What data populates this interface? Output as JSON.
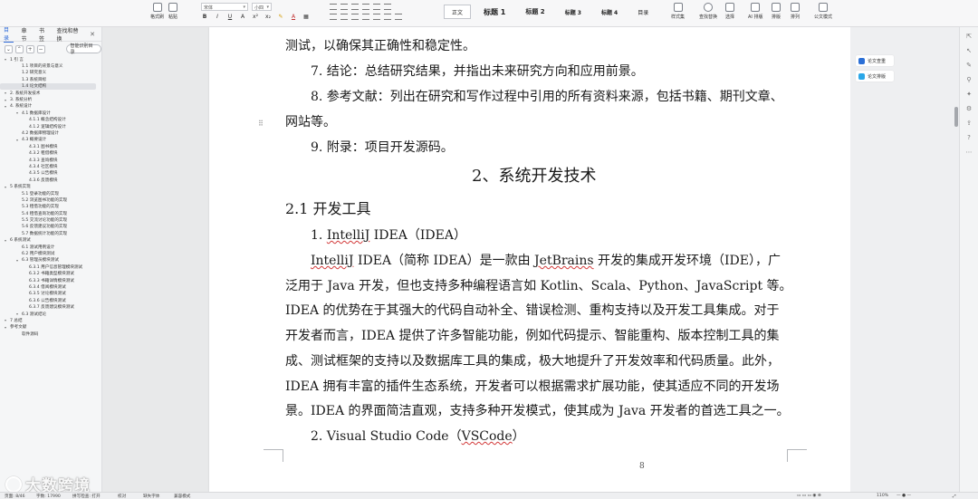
{
  "ribbon": {
    "clipboard": [
      {
        "label": "格式刷"
      },
      {
        "label": "粘贴"
      }
    ],
    "font_name": "宋体",
    "font_size": "小四",
    "styles": [
      {
        "label": "正文"
      },
      {
        "label": "标题 1"
      },
      {
        "label": "标题 2"
      },
      {
        "label": "标题 3"
      },
      {
        "label": "标题 4"
      },
      {
        "label": "目录"
      }
    ],
    "tools": [
      {
        "label": "样式集"
      },
      {
        "label": "查找替换"
      },
      {
        "label": "选择"
      },
      {
        "label": "AI 排版"
      },
      {
        "label": "排版"
      },
      {
        "label": "排列"
      },
      {
        "label": "公文模式"
      }
    ]
  },
  "nav": {
    "tabs": [
      {
        "label": "目录"
      },
      {
        "label": "章节"
      },
      {
        "label": "书签"
      },
      {
        "label": "查找和替换"
      }
    ],
    "smart_label": "智能识别目录",
    "toc": [
      {
        "label": "1  引 言",
        "level": 0
      },
      {
        "label": "1.1  项目的背景与意义",
        "level": 1
      },
      {
        "label": "1.2  研究意义",
        "level": 1
      },
      {
        "label": "1.3  系统目标",
        "level": 1
      },
      {
        "label": "1.4  论文结构",
        "level": 1,
        "selected": true
      },
      {
        "label": "2.  系统开发技术",
        "level": 0
      },
      {
        "label": "3.  系统分析",
        "level": 0
      },
      {
        "label": "4.  系统设计",
        "level": 0
      },
      {
        "label": "4.1  数据库设计",
        "level": 1
      },
      {
        "label": "4.1.1  概念结构设计",
        "level": 2
      },
      {
        "label": "4.1.2  逻辑结构设计",
        "level": 2
      },
      {
        "label": "4.2  数据库物理设计",
        "level": 1
      },
      {
        "label": "4.3  概要设计",
        "level": 1
      },
      {
        "label": "4.3.1  图书模块",
        "level": 2
      },
      {
        "label": "4.3.2  租借模块",
        "level": 2
      },
      {
        "label": "4.3.3  查询模块",
        "level": 2
      },
      {
        "label": "4.3.4  社区模块",
        "level": 2
      },
      {
        "label": "4.3.5  公告模块",
        "level": 2
      },
      {
        "label": "4.3.6  反馈模块",
        "level": 2
      },
      {
        "label": "5  系统实现",
        "level": 0
      },
      {
        "label": "5.1  登录功能的实现",
        "level": 1
      },
      {
        "label": "5.2  浏览图书功能的实现",
        "level": 1
      },
      {
        "label": "5.3  租借功能的实现",
        "level": 1
      },
      {
        "label": "5.4  租借查询功能的实现",
        "level": 1
      },
      {
        "label": "5.5  交流讨论功能的实现",
        "level": 1
      },
      {
        "label": "5.6  反馈建议功能的实现",
        "level": 1
      },
      {
        "label": "5.7  数据统计功能的实现",
        "level": 1
      },
      {
        "label": "6  系统测试",
        "level": 0
      },
      {
        "label": "6.1  测试用例设计",
        "level": 1
      },
      {
        "label": "6.2  用户模块测试",
        "level": 1
      },
      {
        "label": "6.3  管理员模块测试",
        "level": 1
      },
      {
        "label": "6.3.1  用户信息管理模块测试",
        "level": 2
      },
      {
        "label": "6.3.2  书籍类型模块测试",
        "level": 2
      },
      {
        "label": "6.3.3  书籍详情模块测试",
        "level": 2
      },
      {
        "label": "6.3.4  借阅模块测试",
        "level": 2
      },
      {
        "label": "6.3.5  讨论模块测试",
        "level": 2
      },
      {
        "label": "6.3.6  公告模块测试",
        "level": 2
      },
      {
        "label": "6.3.7  反馈建议模块测试",
        "level": 2
      },
      {
        "label": "6.3  测试结论",
        "level": 1
      },
      {
        "label": "7  总结",
        "level": 0
      },
      {
        "label": "参考文献",
        "level": 0
      },
      {
        "label": "软件源码",
        "level": 1
      }
    ]
  },
  "document": {
    "p1": "测试，以确保其正确性和稳定性。",
    "p2": "7. 结论：总结研究结果，并指出未来研究方向和应用前景。",
    "p3a": "8. 参考文献：列出在研究和写作过程中引用的所有资料来源，包括书籍、期刊文章、",
    "p3b": "网站等。",
    "p4": "9. 附录：项目开发源码。",
    "h1": "2、系统开发技术",
    "h2": "2.1 开发工具",
    "item1_pre": "1. ",
    "item1_word": "IntelliJ",
    "item1_post": " IDEA（IDEA）",
    "body": [
      {
        "pre": "",
        "u1": "IntelliJ",
        "mid": " IDEA（简称 IDEA）是一款由 ",
        "u2": "JetBrains",
        "post": " 开发的集成开发环境（IDE），广"
      },
      {
        "pre": "泛用于 Java 开发，但也支持多种编程语言如 Kotlin、Scala、Python、JavaScript 等。",
        "u1": "",
        "mid": "",
        "u2": "",
        "post": ""
      },
      {
        "pre": "IDEA 的优势在于其强大的代码自动补全、错误检测、重构支持以及开发工具集成。对于",
        "u1": "",
        "mid": "",
        "u2": "",
        "post": ""
      },
      {
        "pre": "开发者而言，IDEA 提供了许多智能功能，例如代码提示、智能重构、版本控制工具的集",
        "u1": "",
        "mid": "",
        "u2": "",
        "post": ""
      },
      {
        "pre": "成、测试框架的支持以及数据库工具的集成，极大地提升了开发效率和代码质量。此外，",
        "u1": "",
        "mid": "",
        "u2": "",
        "post": ""
      },
      {
        "pre": "IDEA 拥有丰富的插件生态系统，开发者可以根据需求扩展功能，使其适应不同的开发场",
        "u1": "",
        "mid": "",
        "u2": "",
        "post": ""
      },
      {
        "pre": "景。IDEA 的界面简洁直观，支持多种开发模式，使其成为 Java 开发者的首选工具之一。",
        "u1": "",
        "mid": "",
        "u2": "",
        "post": ""
      }
    ],
    "item2_pre": "2. Visual Studio Code（",
    "item2_word": "VSCode",
    "item2_post": "）",
    "page_number": "8"
  },
  "side_panel": {
    "items": [
      {
        "label": "论文查重",
        "color": "#2b6fd6"
      },
      {
        "label": "论文排版",
        "color": "#2aa7e8"
      }
    ]
  },
  "status": {
    "page": "页面: 8/46",
    "words": "字数: 17990",
    "spell": "拼写检查: 打开",
    "proof": "校对",
    "missing_font": "缺失字体",
    "compat": "兼容模式",
    "zoom": "110%"
  },
  "watermark": "大数跨境"
}
